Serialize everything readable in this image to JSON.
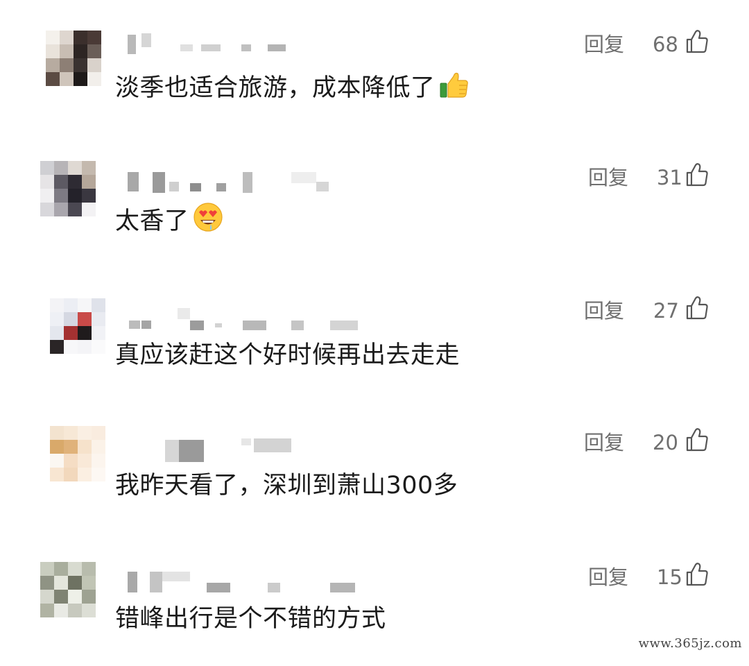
{
  "comments": [
    {
      "text": "淡季也适合旅游，成本降低了",
      "emoji": "thumbs-up-emoji",
      "reply_label": "回复",
      "likes": "68"
    },
    {
      "text": "太香了",
      "emoji": "heart-eyes-drooling-emoji",
      "reply_label": "回复",
      "likes": "31"
    },
    {
      "text": "真应该赶这个好时候再出去走走",
      "emoji": "",
      "reply_label": "回复",
      "likes": "27"
    },
    {
      "text": "我昨天看了，深圳到萧山300多",
      "emoji": "",
      "reply_label": "回复",
      "likes": "20"
    },
    {
      "text": "错峰出行是个不错的方式",
      "emoji": "",
      "reply_label": "回复",
      "likes": "15"
    }
  ],
  "icons": {
    "like": "thumbs-up-outline-icon",
    "avatar": "pixelated-avatar",
    "username": "pixelated-username"
  },
  "colors": {
    "text": "#1b1b1b",
    "meta": "#6f6f6f",
    "background": "#ffffff"
  },
  "watermark": "www.365jz.com"
}
